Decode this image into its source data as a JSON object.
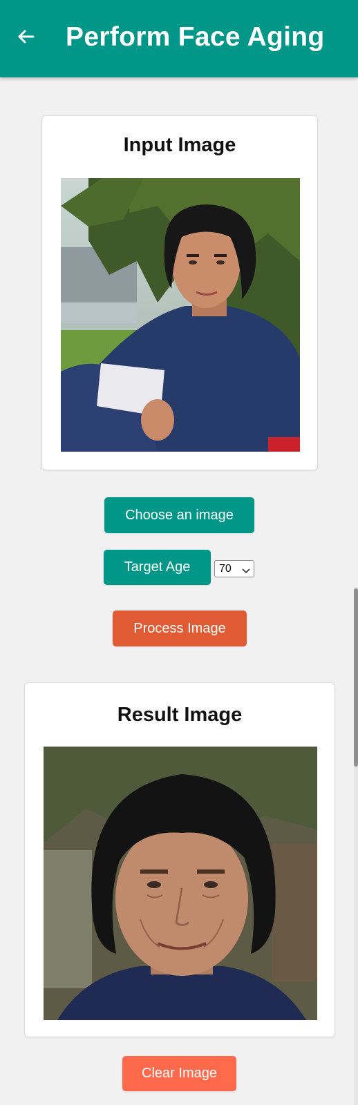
{
  "header": {
    "title": "Perform Face Aging",
    "back_icon": "arrow-left-icon",
    "color": "#009688"
  },
  "input_card": {
    "title": "Input Image"
  },
  "controls": {
    "choose_label": "Choose an image",
    "target_age_label": "Target Age",
    "age_value": "70",
    "process_label": "Process Image"
  },
  "result_card": {
    "title": "Result Image"
  },
  "footer": {
    "clear_label": "Clear Image"
  },
  "colors": {
    "teal": "#009688",
    "process_orange": "#e05a33",
    "clear_coral": "#ff6a4d",
    "background": "#f1f1f1"
  }
}
